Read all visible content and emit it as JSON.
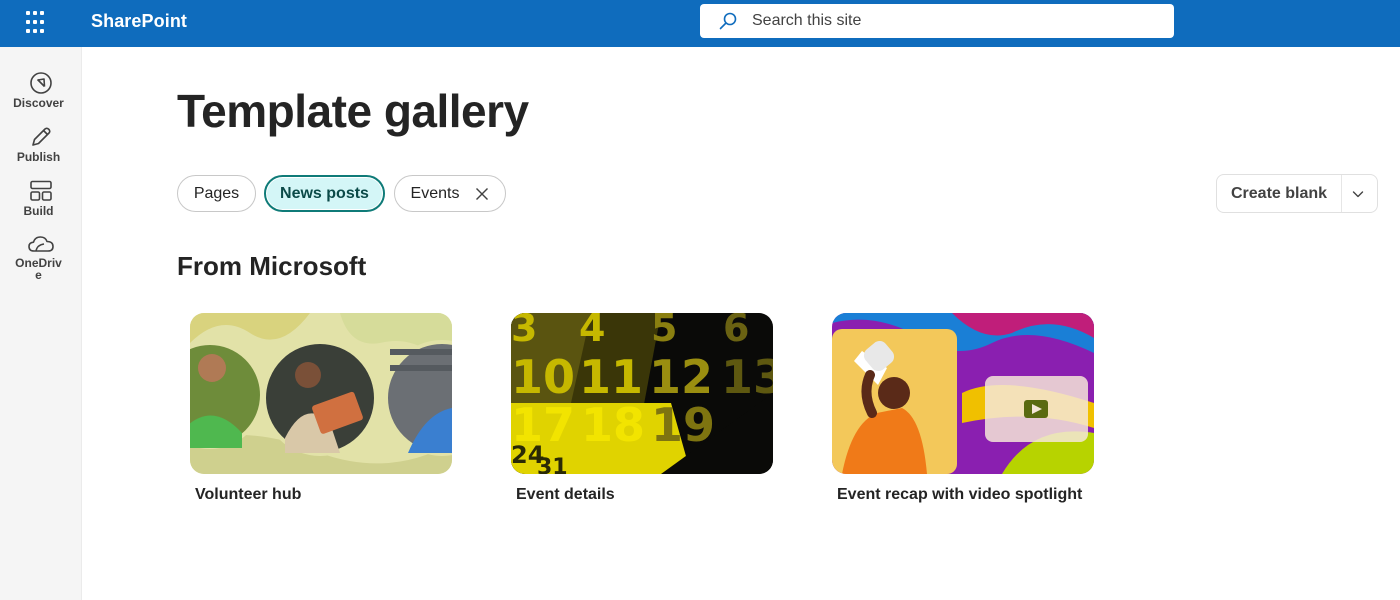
{
  "topbar": {
    "app_name": "SharePoint",
    "search_placeholder": "Search this site",
    "bar_color": "#0f6cbd"
  },
  "rail": {
    "items": [
      {
        "label": "Discover",
        "icon": "compass-icon"
      },
      {
        "label": "Publish",
        "icon": "pen-icon"
      },
      {
        "label": "Build",
        "icon": "layout-icon"
      },
      {
        "label": "OneDrive",
        "icon": "cloud-icon"
      }
    ]
  },
  "main": {
    "title": "Template gallery",
    "filters": [
      {
        "label": "Pages",
        "active": false
      },
      {
        "label": "News posts",
        "active": true
      },
      {
        "label": "Events",
        "active": false,
        "removable": true
      }
    ],
    "create_button": "Create blank",
    "section_title": "From Microsoft",
    "cards": [
      {
        "title": "Volunteer hub",
        "image": "volunteer-people-circles"
      },
      {
        "title": "Event details",
        "image": "yellow-calendar-numbers"
      },
      {
        "title": "Event recap with video spotlight",
        "image": "megaphone-video-colorful"
      }
    ],
    "accent_color": "#0f7b78"
  }
}
